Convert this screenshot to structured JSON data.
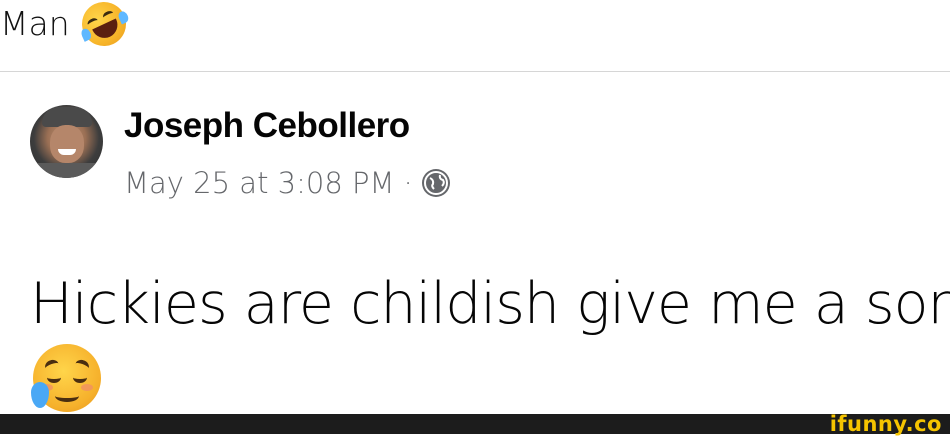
{
  "caption": {
    "text": "Man",
    "emoji": "rolling-on-floor-laughing"
  },
  "post": {
    "author": "Joseph Cebollero",
    "timestamp": "May 25 at 3:08 PM",
    "separator": "·",
    "audience_icon": "globe-icon",
    "body": "Hickies are childish give me a son",
    "body_emoji": "sad-but-relieved-face"
  },
  "watermark": {
    "text": "ifunny.co"
  },
  "colors": {
    "meta": "#65676b",
    "footer": "#1c1c1c",
    "watermark": "#f5c400"
  }
}
